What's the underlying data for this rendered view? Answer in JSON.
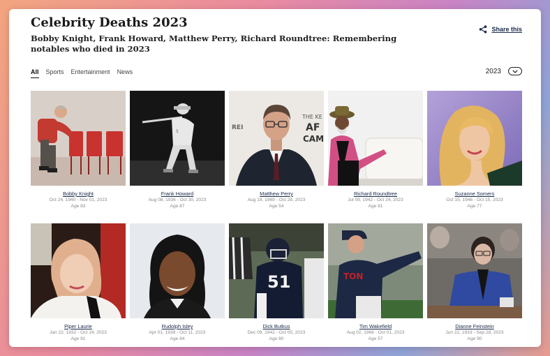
{
  "page": {
    "title": "Celebrity Deaths 2023",
    "subtitle": "Bobby Knight, Frank Howard, Matthew Perry, Richard Roundtree: Remembering notables who died in 2023",
    "share_label": "Share this"
  },
  "tabs": [
    {
      "label": "All",
      "active": true
    },
    {
      "label": "Sports",
      "active": false
    },
    {
      "label": "Entertainment",
      "active": false
    },
    {
      "label": "News",
      "active": false
    }
  ],
  "year_filter": {
    "value": "2023"
  },
  "people": [
    {
      "name": "Bobby Knight",
      "dates": "Oct 24, 1940 - Nov 01, 2023",
      "age": "Age 83"
    },
    {
      "name": "Frank Howard",
      "dates": "Aug 08, 1936 - Oct 30, 2023",
      "age": "Age 87"
    },
    {
      "name": "Matthew Perry",
      "dates": "Aug 19, 1969 - Oct 28, 2023",
      "age": "Age 54"
    },
    {
      "name": "Richard Roundtree",
      "dates": "Jul 09, 1942 - Oct 24, 2023",
      "age": "Age 81"
    },
    {
      "name": "Suzanne Somers",
      "dates": "Oct 15, 1946 - Oct 15, 2023",
      "age": "Age 77"
    },
    {
      "name": "Piper Laurie",
      "dates": "Jan 22, 1932 - Oct 14, 2023",
      "age": "Age 91"
    },
    {
      "name": "Rudolph Isley",
      "dates": "Apr 01, 1939 - Oct 11, 2023",
      "age": "Age 84"
    },
    {
      "name": "Dick Butkus",
      "dates": "Dec 09, 1942 - Oct 05, 2023",
      "age": "Age 80"
    },
    {
      "name": "Tim Wakefield",
      "dates": "Aug 02, 1966 - Oct 01, 2023",
      "age": "Age 57"
    },
    {
      "name": "Dianne Feinstein",
      "dates": "Jun 22, 1933 - Sep 28, 2023",
      "age": "Age 90"
    }
  ],
  "photo_text": {
    "perry_backdrop_1": "THE KE",
    "perry_backdrop_2": "AF",
    "perry_backdrop_3": "CAM",
    "perry_backdrop_4": "REI",
    "butkus_jersey": "51",
    "wakefield_jersey": "TON"
  },
  "icons": {
    "share": "share-icon",
    "year_dropdown": "chevron-down-icon"
  }
}
